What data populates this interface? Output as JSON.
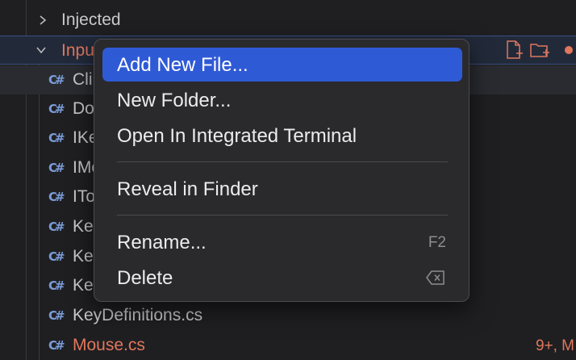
{
  "tree": {
    "folders": [
      {
        "label": "Injected",
        "expanded": false
      },
      {
        "label": "Input",
        "expanded": true
      }
    ],
    "files": [
      {
        "visible": "Cli"
      },
      {
        "visible": "Do"
      },
      {
        "visible": "IKe"
      },
      {
        "visible": "IMo"
      },
      {
        "visible": "ITo"
      },
      {
        "visible": "Ke"
      },
      {
        "visible": "Ke"
      },
      {
        "visible": "Ke"
      },
      {
        "visible": "KeyDefinitions.cs"
      },
      {
        "visible": "Mouse.cs",
        "status": "9+, M"
      }
    ],
    "file_icon_glyph": "C#"
  },
  "context_menu": {
    "items": [
      {
        "label": "Add New File...",
        "active": true
      },
      {
        "label": "New Folder..."
      },
      {
        "label": "Open In Integrated Terminal"
      },
      {
        "label": "Reveal in Finder"
      },
      {
        "label": "Rename...",
        "shortcut": "F2"
      },
      {
        "label": "Delete",
        "shortcut_icon": "delete-key-icon"
      }
    ]
  },
  "colors": {
    "accent": "#2f5ad6",
    "modified": "#e0775c",
    "background": "#1f1f22",
    "menu_bg": "#2a2a2d"
  }
}
